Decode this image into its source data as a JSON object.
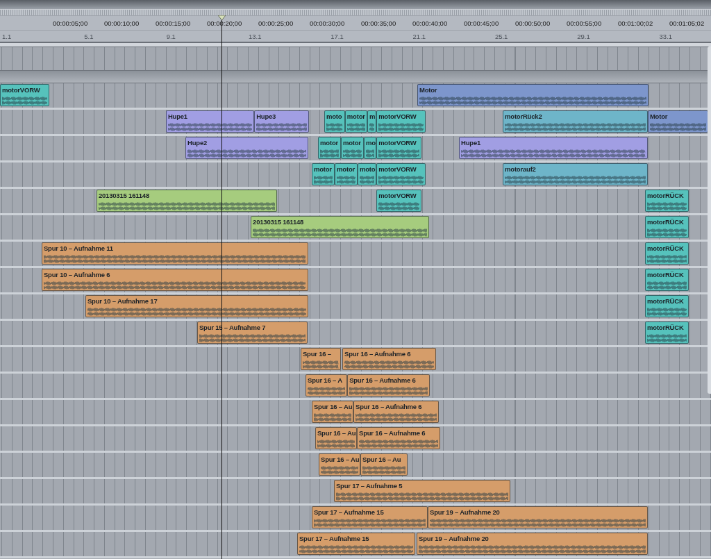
{
  "ruler": {
    "timecodes": [
      "00:00:05;00",
      "00:00:10;00",
      "00:00:15;00",
      "00:00:20;00",
      "00:00:25;00",
      "00:00:30;00",
      "00:00:35;00",
      "00:00:40;00",
      "00:00:45;00",
      "00:00:50;00",
      "00:00:55;00",
      "00:01:00;02",
      "00:01:05;02"
    ],
    "bars": [
      "1.1",
      "5.1",
      "9.1",
      "13.1",
      "17.1",
      "21.1",
      "25.1",
      "29.1",
      "33.1"
    ]
  },
  "tracks": [
    {
      "regions": [
        {
          "name": "motorVORW",
          "color": "#56c2bc"
        },
        {
          "name": "Motor",
          "color": "#7d96cc"
        }
      ]
    },
    {
      "regions": [
        {
          "name": "Hupe1",
          "color": "#a19ee3"
        },
        {
          "name": "Hupe3",
          "color": "#a19ee3"
        },
        {
          "name": "moto",
          "color": "#56c2bc"
        },
        {
          "name": "motor",
          "color": "#56c2bc"
        },
        {
          "name": "m",
          "color": "#56c2bc"
        },
        {
          "name": "motorVORW",
          "color": "#56c2bc"
        },
        {
          "name": "motorRück2",
          "color": "#6eb5c9"
        },
        {
          "name": "Motor",
          "color": "#7d96cc"
        }
      ]
    },
    {
      "regions": [
        {
          "name": "Hupe2",
          "color": "#a19ee3"
        },
        {
          "name": "motor",
          "color": "#56c2bc"
        },
        {
          "name": "motor",
          "color": "#56c2bc"
        },
        {
          "name": "mo",
          "color": "#56c2bc"
        },
        {
          "name": "motorVORW",
          "color": "#56c2bc"
        },
        {
          "name": "Hupe1",
          "color": "#a19ee3"
        }
      ]
    },
    {
      "regions": [
        {
          "name": "motor",
          "color": "#56c2bc"
        },
        {
          "name": "motor",
          "color": "#56c2bc"
        },
        {
          "name": "moto",
          "color": "#56c2bc"
        },
        {
          "name": "motorVORW",
          "color": "#56c2bc"
        },
        {
          "name": "motorauf2",
          "color": "#6eb5c9"
        }
      ]
    },
    {
      "regions": [
        {
          "name": "20130315 161148",
          "color": "#a6cc7e"
        },
        {
          "name": "motorVORW",
          "color": "#56c2bc"
        },
        {
          "name": "motorRÜCK",
          "color": "#56c2bc"
        }
      ]
    },
    {
      "regions": [
        {
          "name": "20130315 161148",
          "color": "#a6cc7e"
        },
        {
          "name": "motorRÜCK",
          "color": "#56c2bc"
        }
      ]
    },
    {
      "regions": [
        {
          "name": "Spur 10 – Aufnahme 11",
          "color": "#d59d6a"
        },
        {
          "name": "motorRÜCK",
          "color": "#56c2bc"
        }
      ]
    },
    {
      "regions": [
        {
          "name": "Spur 10 – Aufnahme 6",
          "color": "#d59d6a"
        },
        {
          "name": "motorRÜCK",
          "color": "#56c2bc"
        }
      ]
    },
    {
      "regions": [
        {
          "name": "Spur 10 – Aufnahme 17",
          "color": "#d59d6a"
        },
        {
          "name": "motorRÜCK",
          "color": "#56c2bc"
        }
      ]
    },
    {
      "regions": [
        {
          "name": "Spur 15 – Aufnahme 7",
          "color": "#d59d6a"
        },
        {
          "name": "motorRÜCK",
          "color": "#56c2bc"
        }
      ]
    },
    {
      "regions": [
        {
          "name": "Spur 16 –",
          "color": "#d59d6a"
        },
        {
          "name": "Spur 16 – Aufnahme 6",
          "color": "#d59d6a"
        }
      ]
    },
    {
      "regions": [
        {
          "name": "Spur 16 – A",
          "color": "#d59d6a"
        },
        {
          "name": "Spur 16 – Aufnahme 6",
          "color": "#d59d6a"
        }
      ]
    },
    {
      "regions": [
        {
          "name": "Spur 16 – Au",
          "color": "#d59d6a"
        },
        {
          "name": "Spur 16 – Aufnahme 6",
          "color": "#d59d6a"
        }
      ]
    },
    {
      "regions": [
        {
          "name": "Spur 16 – Au",
          "color": "#d59d6a"
        },
        {
          "name": "Spur 16 – Aufnahme 6",
          "color": "#d59d6a"
        }
      ]
    },
    {
      "regions": [
        {
          "name": "Spur 16 – Au",
          "color": "#d59d6a"
        },
        {
          "name": "Spur 16 – Au",
          "color": "#d59d6a"
        }
      ]
    },
    {
      "regions": [
        {
          "name": "Spur 17 – Aufnahme 5",
          "color": "#d59d6a"
        }
      ]
    },
    {
      "regions": [
        {
          "name": "Spur 17 – Aufnahme 15",
          "color": "#d59d6a"
        },
        {
          "name": "Spur 19 – Aufnahme 20",
          "color": "#d59d6a"
        }
      ]
    },
    {
      "regions": [
        {
          "name": "Spur 17 – Aufnahme 15",
          "color": "#d59d6a"
        },
        {
          "name": "Spur 19 – Aufnahme 20",
          "color": "#d59d6a"
        }
      ]
    }
  ]
}
